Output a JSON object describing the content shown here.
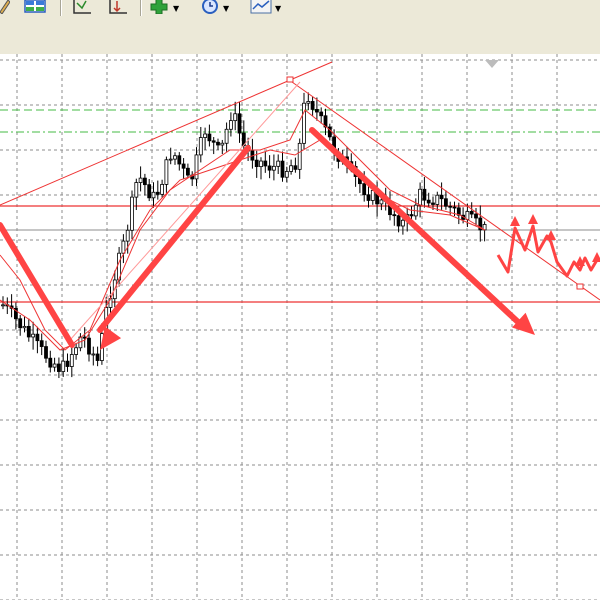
{
  "toolbar": {
    "buttons": [
      {
        "icon": "pencil-icon",
        "has_dropdown": false
      },
      {
        "icon": "window-tiles-icon",
        "has_dropdown": false
      },
      {
        "icon": "chart-shift-icon",
        "has_dropdown": false
      },
      {
        "icon": "autoscroll-icon",
        "has_dropdown": false
      },
      {
        "icon": "add-indicator-icon",
        "has_dropdown": true
      },
      {
        "icon": "period-clock-icon",
        "has_dropdown": true
      },
      {
        "icon": "template-icon",
        "has_dropdown": true
      }
    ]
  },
  "colors": {
    "bull_candle": "#ffffff",
    "bear_candle": "#000000",
    "grid": "#8c8c8c",
    "trend_red": "#ee3333",
    "arrow_red": "#ff4444",
    "green_level": "#44bb44",
    "grey_level": "#8e8e8e",
    "scroll_marker": "#bcbcbc"
  }
}
